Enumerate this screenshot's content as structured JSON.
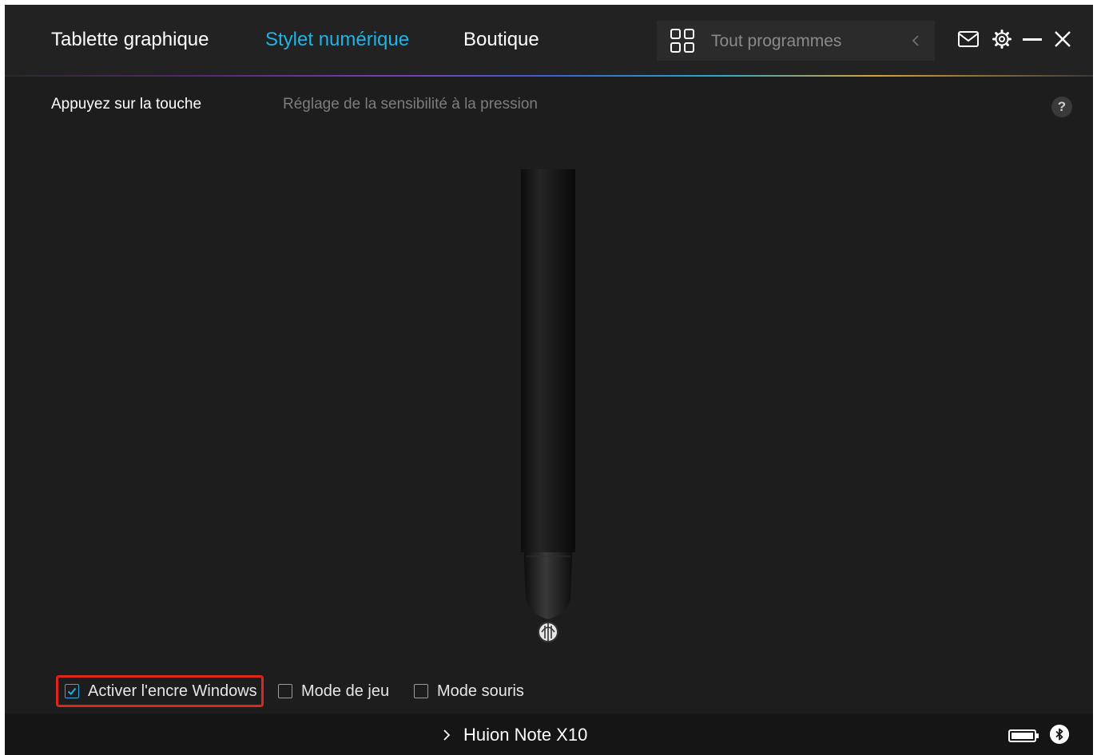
{
  "header": {
    "tabs": [
      {
        "label": "Tablette graphique",
        "active": false
      },
      {
        "label": "Stylet numérique",
        "active": true
      },
      {
        "label": "Boutique",
        "active": false
      }
    ],
    "program_selector": {
      "label": "Tout programmes"
    }
  },
  "subtabs": {
    "press_key": "Appuyez sur la touche",
    "pressure": "Réglage de la sensibilité à la pression",
    "help": "?"
  },
  "options": [
    {
      "label": "Activer l'encre Windows",
      "checked": true
    },
    {
      "label": "Mode de jeu",
      "checked": false
    },
    {
      "label": "Mode souris",
      "checked": false
    }
  ],
  "footer": {
    "device_name": "Huion Note X10"
  },
  "colors": {
    "accent": "#1fb4e6",
    "highlight": "#e0261c",
    "background": "#1d1d1d"
  }
}
